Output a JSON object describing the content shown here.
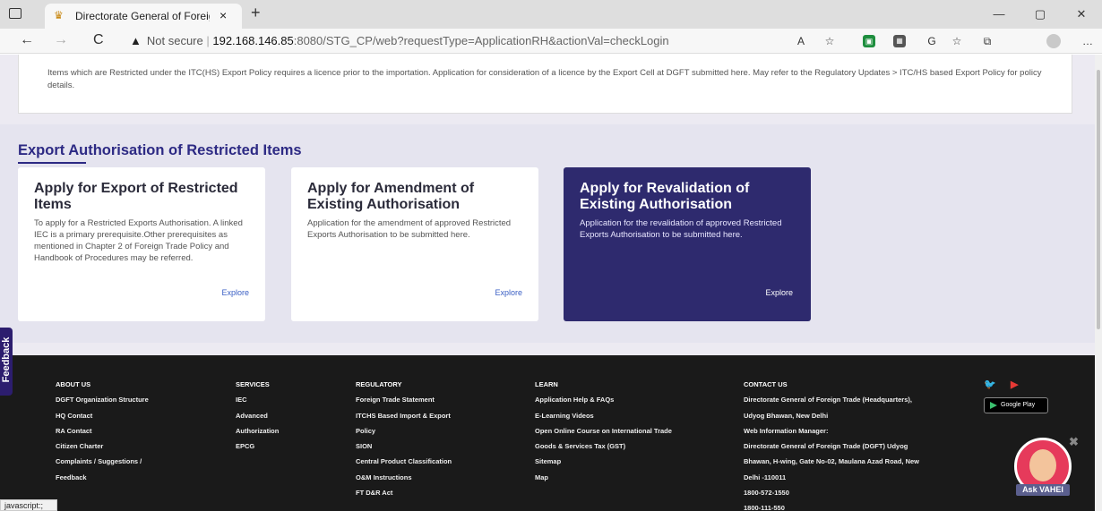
{
  "browser": {
    "tab_title": "Directorate General of Foreign Tr",
    "new_tab": "+",
    "close_tab": "×",
    "minimize": "—",
    "restore": "▢",
    "close_window": "✕",
    "back": "←",
    "forward": "→",
    "reload": "C",
    "security_label": "Not secure",
    "url_host": "192.168.146.85",
    "url_rest": ":8080/STG_CP/web?requestType=ApplicationRH&actionVal=checkLogin",
    "status_text": "javascript:;"
  },
  "info": {
    "text": "Items which are Restricted under the ITC(HS) Export Policy requires a licence prior to the importation. Application for consideration of a licence by the Export Cell at DGFT submitted here. May refer to the Regulatory Updates > ITC/HS based Export Policy for policy details."
  },
  "section": {
    "title": "Export Authorisation of Restricted Items",
    "cards": [
      {
        "title": "Apply for Export of Restricted Items",
        "text": "To apply for a Restricted Exports Authorisation. A linked IEC is a primary prerequisite.Other prerequisites as mentioned in Chapter 2 of Foreign Trade Policy and Handbook of Procedures may be referred.",
        "link": "Explore"
      },
      {
        "title": "Apply for Amendment of Existing Authorisation",
        "text": "Application for the amendment of approved Restricted Exports Authorisation to be submitted here.",
        "link": "Explore"
      },
      {
        "title": "Apply for Revalidation of Existing Authorisation",
        "text": "Application for the revalidation of approved Restricted Exports Authorisation to be submitted here.",
        "link": "Explore"
      }
    ]
  },
  "footer": {
    "about": {
      "heading": "ABOUT US",
      "items": [
        "DGFT Organization Structure",
        "HQ Contact",
        "RA Contact",
        "Citizen Charter",
        "Complaints / Suggestions /",
        "Feedback"
      ]
    },
    "services": {
      "heading": "SERVICES",
      "items": [
        "IEC",
        "Advanced",
        "Authorization",
        "EPCG"
      ]
    },
    "regulatory": {
      "heading": "REGULATORY",
      "items": [
        "Foreign Trade Statement",
        "ITCHS Based Import & Export",
        "Policy",
        "SION",
        "Central Product Classification",
        "O&M Instructions",
        "FT D&R Act"
      ]
    },
    "learn": {
      "heading": "LEARN",
      "items": [
        "Application Help & FAQs",
        "E-Learning Videos",
        "Open Online Course on International Trade",
        "Goods & Services Tax (GST)",
        "Sitemap",
        "Map"
      ]
    },
    "contact": {
      "heading": "CONTACT US",
      "items": [
        "Directorate General of Foreign Trade (Headquarters),",
        "Udyog Bhawan, New Delhi",
        "Web Information Manager:",
        "Directorate General of Foreign Trade (DGFT) Udyog",
        "Bhawan, H-wing, Gate No-02, Maulana Azad Road, New",
        "Delhi -110011",
        "1800-572-1550",
        "1800-111-550"
      ]
    },
    "google_play": "Google Play",
    "feedback": "Feedback",
    "assistant": "Ask VAHEI"
  }
}
